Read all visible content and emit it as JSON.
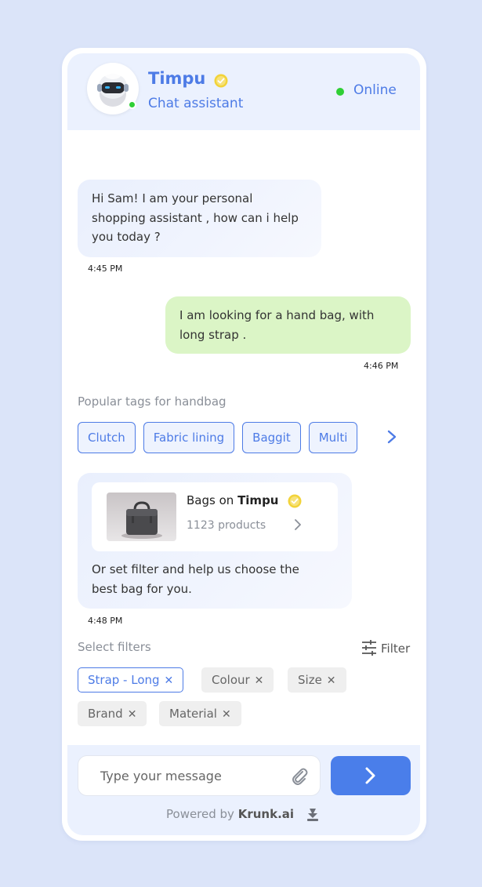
{
  "header": {
    "bot_name": "Timpu",
    "bot_role": "Chat assistant",
    "status": "Online"
  },
  "messages": [
    {
      "from": "bot",
      "text": "Hi Sam! I am your personal shopping assistant , how can i help you today ?",
      "time": "4:45 PM"
    },
    {
      "from": "user",
      "text": "I am looking for a hand bag, with long strap .",
      "time": "4:46 PM"
    }
  ],
  "popular_tags": {
    "label": "Popular tags for handbag",
    "tags": [
      "Clutch",
      "Fabric lining",
      "Baggit",
      "Multi"
    ]
  },
  "product_card": {
    "title_prefix": "Bags on",
    "title_brand": "Timpu",
    "count": "1123 products",
    "message": "Or set filter and help us choose the best bag for you.",
    "time": "4:48 PM"
  },
  "filters": {
    "label": "Select filters",
    "button_label": "Filter",
    "chips": [
      {
        "label": "Strap - Long",
        "active": true
      },
      {
        "label": "Colour",
        "active": false
      },
      {
        "label": "Size",
        "active": false
      },
      {
        "label": "Brand",
        "active": false
      },
      {
        "label": "Material",
        "active": false
      }
    ]
  },
  "composer": {
    "placeholder": "Type your message",
    "powered_by": "Powered by",
    "powered_brand": "Krunk.ai"
  },
  "colors": {
    "accent": "#4d7be6",
    "online": "#2fcf35",
    "user_bubble": "#dbf5c6",
    "verified": "#f2d33a"
  },
  "icons": [
    "verified-icon",
    "chevron-right-icon",
    "filter-icon",
    "close-icon",
    "attach-icon",
    "send-icon",
    "brand-icon"
  ]
}
